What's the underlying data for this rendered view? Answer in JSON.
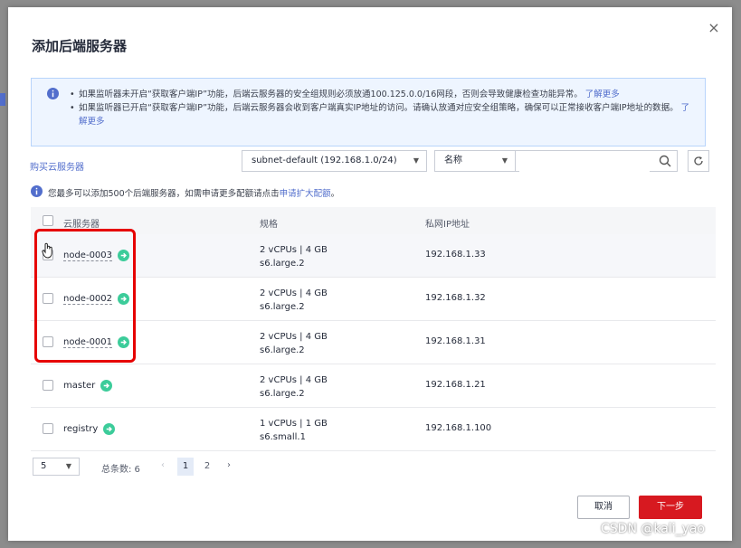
{
  "dialog": {
    "title": "添加后端服务器",
    "close_glyph": "×"
  },
  "notice": {
    "line1": "如果监听器未开启“获取客户端IP”功能，后端云服务器的安全组规则必须放通100.125.0.0/16网段，否则会导致健康检查功能异常。",
    "line1_link": "了解更多",
    "line2": "如果监听器已开启“获取客户端IP”功能，后端云服务器会收到客户端真实IP地址的访问。请确认放通对应安全组策略，确保可以正常接收客户端IP地址的数据。",
    "line2_link": "了解更多"
  },
  "toolbar": {
    "buy_link": "购买云服务器",
    "subnet_value": "subnet-default (192.168.1.0/24)",
    "filter_field": "名称",
    "search_placeholder": ""
  },
  "quota": {
    "text": "您最多可以添加500个后端服务器，如需申请更多配额请点击",
    "link": "申请扩大配额",
    "end": "。"
  },
  "table": {
    "headers": {
      "name": "云服务器",
      "spec": "规格",
      "ip": "私网IP地址"
    },
    "rows": [
      {
        "name": "node-0003",
        "spec_line1": "2 vCPUs | 4 GB",
        "spec_line2": "s6.large.2",
        "ip": "192.168.1.33"
      },
      {
        "name": "node-0002",
        "spec_line1": "2 vCPUs | 4 GB",
        "spec_line2": "s6.large.2",
        "ip": "192.168.1.32"
      },
      {
        "name": "node-0001",
        "spec_line1": "2 vCPUs | 4 GB",
        "spec_line2": "s6.large.2",
        "ip": "192.168.1.31"
      },
      {
        "name": "master",
        "spec_line1": "2 vCPUs | 4 GB",
        "spec_line2": "s6.large.2",
        "ip": "192.168.1.21"
      },
      {
        "name": "registry",
        "spec_line1": "1 vCPUs | 1 GB",
        "spec_line2": "s6.small.1",
        "ip": "192.168.1.100"
      }
    ]
  },
  "pagination": {
    "page_size": "5",
    "total": "总条数: 6",
    "pages": [
      "1",
      "2"
    ],
    "current_page": "1"
  },
  "footer": {
    "cancel": "取消",
    "next": "下一步"
  },
  "watermark": "CSDN @kali_yao",
  "colors": {
    "primary_button": "#d71920",
    "link": "#526ecc",
    "highlight_box": "#e60000",
    "go_icon": "#3ccc9a",
    "notice_bg": "#eef5ff"
  }
}
